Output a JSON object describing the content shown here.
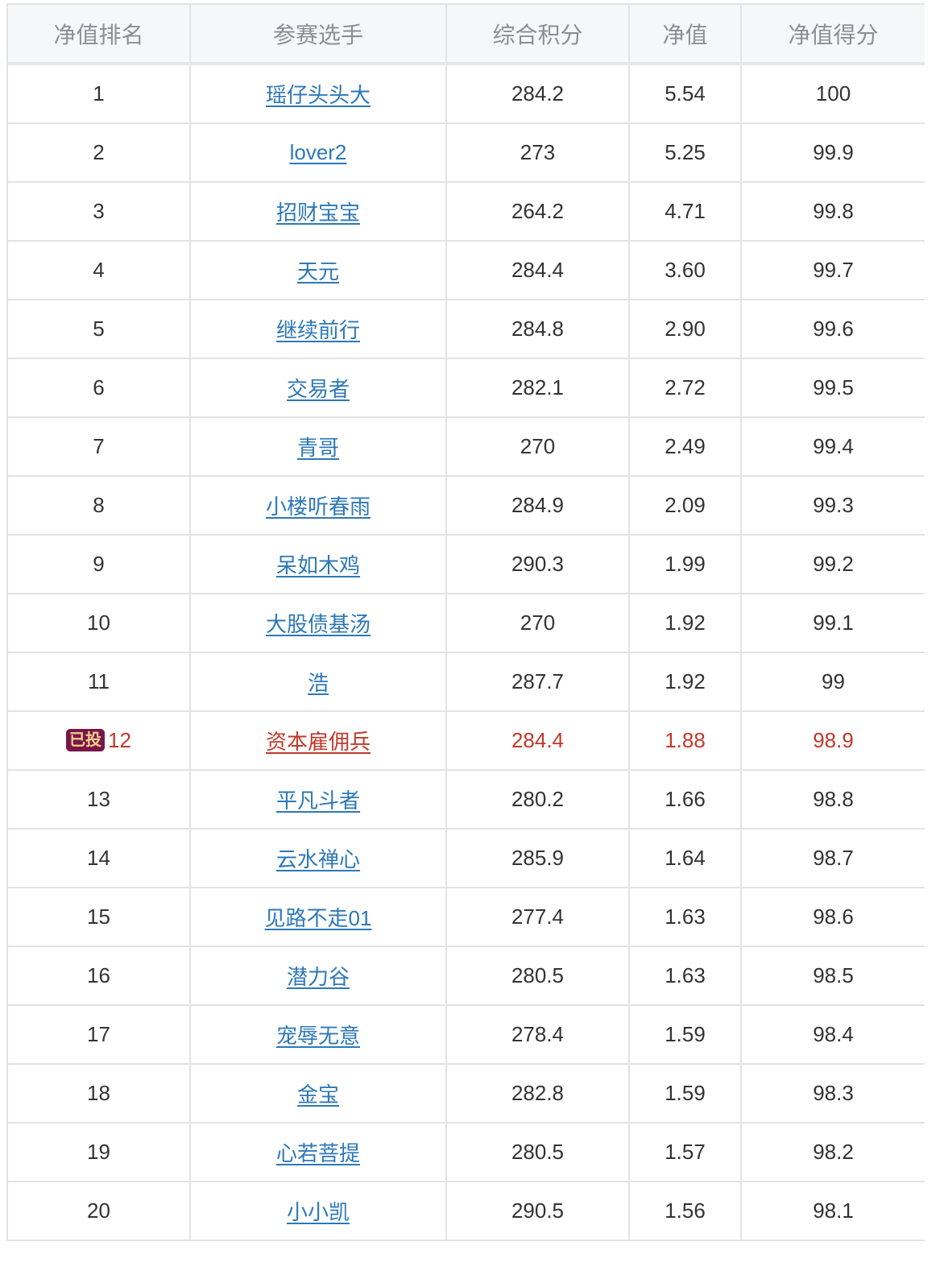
{
  "table": {
    "headers": {
      "rank": "净值排名",
      "player": "参赛选手",
      "score": "综合积分",
      "nav": "净值",
      "nav_score": "净值得分"
    },
    "badge_label": "已投",
    "highlight_color": "#c0392b",
    "link_color": "#2d78b7",
    "rows": [
      {
        "rank": "1",
        "player": "瑶仔头头大",
        "score": "284.2",
        "nav": "5.54",
        "nav_score": "100"
      },
      {
        "rank": "2",
        "player": "lover2",
        "score": "273",
        "nav": "5.25",
        "nav_score": "99.9"
      },
      {
        "rank": "3",
        "player": "招财宝宝",
        "score": "264.2",
        "nav": "4.71",
        "nav_score": "99.8"
      },
      {
        "rank": "4",
        "player": "天元",
        "score": "284.4",
        "nav": "3.60",
        "nav_score": "99.7"
      },
      {
        "rank": "5",
        "player": "继续前行",
        "score": "284.8",
        "nav": "2.90",
        "nav_score": "99.6"
      },
      {
        "rank": "6",
        "player": "交易者",
        "score": "282.1",
        "nav": "2.72",
        "nav_score": "99.5"
      },
      {
        "rank": "7",
        "player": "青哥",
        "score": "270",
        "nav": "2.49",
        "nav_score": "99.4"
      },
      {
        "rank": "8",
        "player": "小楼听春雨",
        "score": "284.9",
        "nav": "2.09",
        "nav_score": "99.3"
      },
      {
        "rank": "9",
        "player": "呆如木鸡",
        "score": "290.3",
        "nav": "1.99",
        "nav_score": "99.2"
      },
      {
        "rank": "10",
        "player": "大股债基汤",
        "score": "270",
        "nav": "1.92",
        "nav_score": "99.1"
      },
      {
        "rank": "11",
        "player": "浩",
        "score": "287.7",
        "nav": "1.92",
        "nav_score": "99"
      },
      {
        "rank": "12",
        "player": "资本雇佣兵",
        "score": "284.4",
        "nav": "1.88",
        "nav_score": "98.9",
        "voted": true
      },
      {
        "rank": "13",
        "player": "平凡斗者",
        "score": "280.2",
        "nav": "1.66",
        "nav_score": "98.8"
      },
      {
        "rank": "14",
        "player": "云水禅心",
        "score": "285.9",
        "nav": "1.64",
        "nav_score": "98.7"
      },
      {
        "rank": "15",
        "player": "见路不走01",
        "score": "277.4",
        "nav": "1.63",
        "nav_score": "98.6"
      },
      {
        "rank": "16",
        "player": "潜力谷",
        "score": "280.5",
        "nav": "1.63",
        "nav_score": "98.5"
      },
      {
        "rank": "17",
        "player": "宠辱无意",
        "score": "278.4",
        "nav": "1.59",
        "nav_score": "98.4"
      },
      {
        "rank": "18",
        "player": "金宝",
        "score": "282.8",
        "nav": "1.59",
        "nav_score": "98.3"
      },
      {
        "rank": "19",
        "player": "心若菩提",
        "score": "280.5",
        "nav": "1.57",
        "nav_score": "98.2"
      },
      {
        "rank": "20",
        "player": "小小凯",
        "score": "290.5",
        "nav": "1.56",
        "nav_score": "98.1"
      }
    ]
  }
}
